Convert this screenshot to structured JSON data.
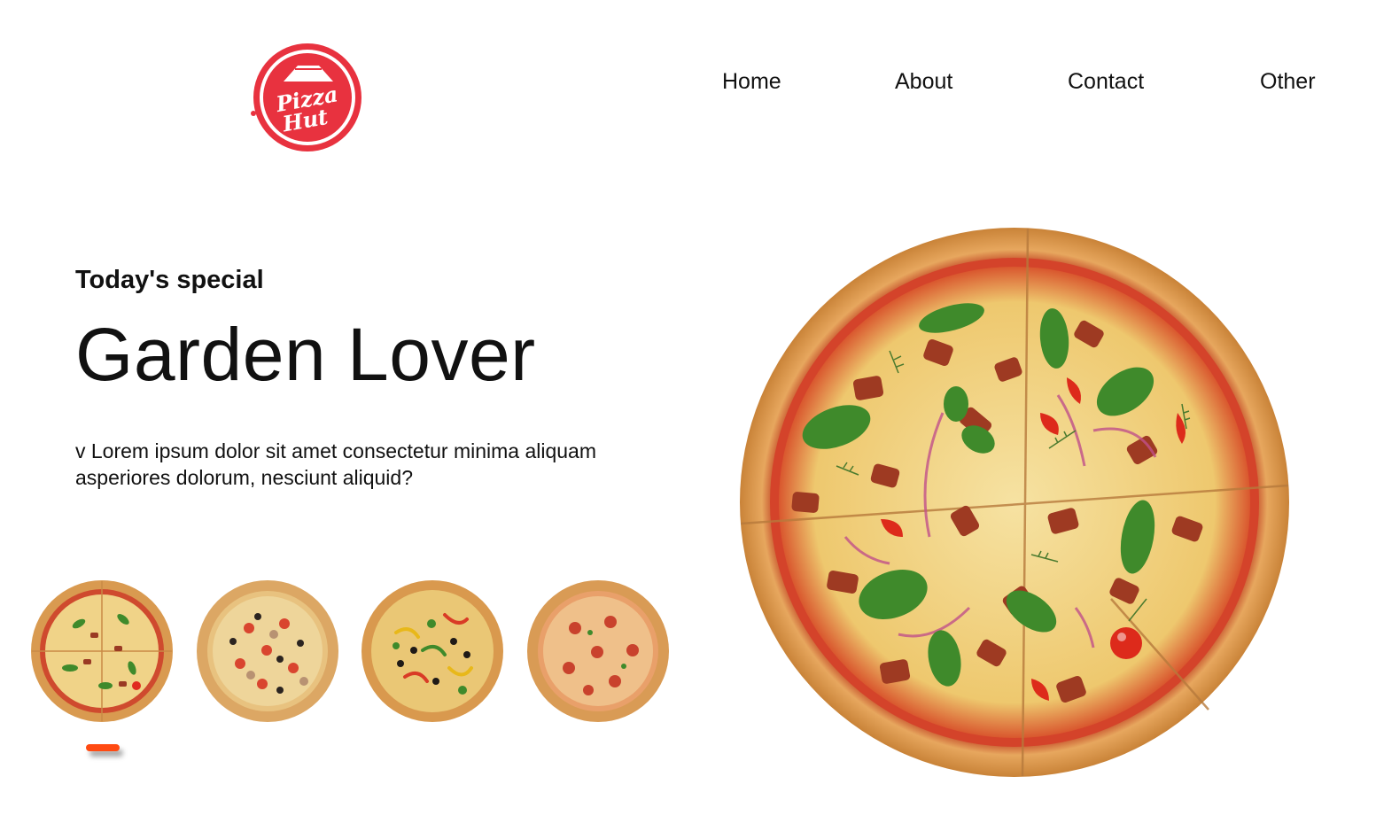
{
  "brand": {
    "logo_text_line1": "Pizza",
    "logo_text_line2": "Hut",
    "logo_color": "#e8323f"
  },
  "nav": {
    "items": [
      {
        "label": "Home"
      },
      {
        "label": "About"
      },
      {
        "label": "Contact"
      },
      {
        "label": "Other"
      }
    ]
  },
  "hero": {
    "eyebrow": "Today's special",
    "title": "Garden Lover",
    "description": "v Lorem ipsum dolor sit amet consectetur minima aliquam asperiores dolorum, nesciunt aliquid?"
  },
  "carousel": {
    "thumbnails": [
      {
        "icon": "pizza-garden-lover-icon"
      },
      {
        "icon": "pizza-mushroom-olive-icon"
      },
      {
        "icon": "pizza-veggie-supreme-icon"
      },
      {
        "icon": "pizza-pepperoni-icon"
      }
    ],
    "active_index": 0,
    "indicator_color": "#ff4a12"
  },
  "colors": {
    "crust": "#e2a35b",
    "sauce": "#d8452b",
    "cheese": "#f1d78e",
    "basil": "#3f8a2b"
  }
}
